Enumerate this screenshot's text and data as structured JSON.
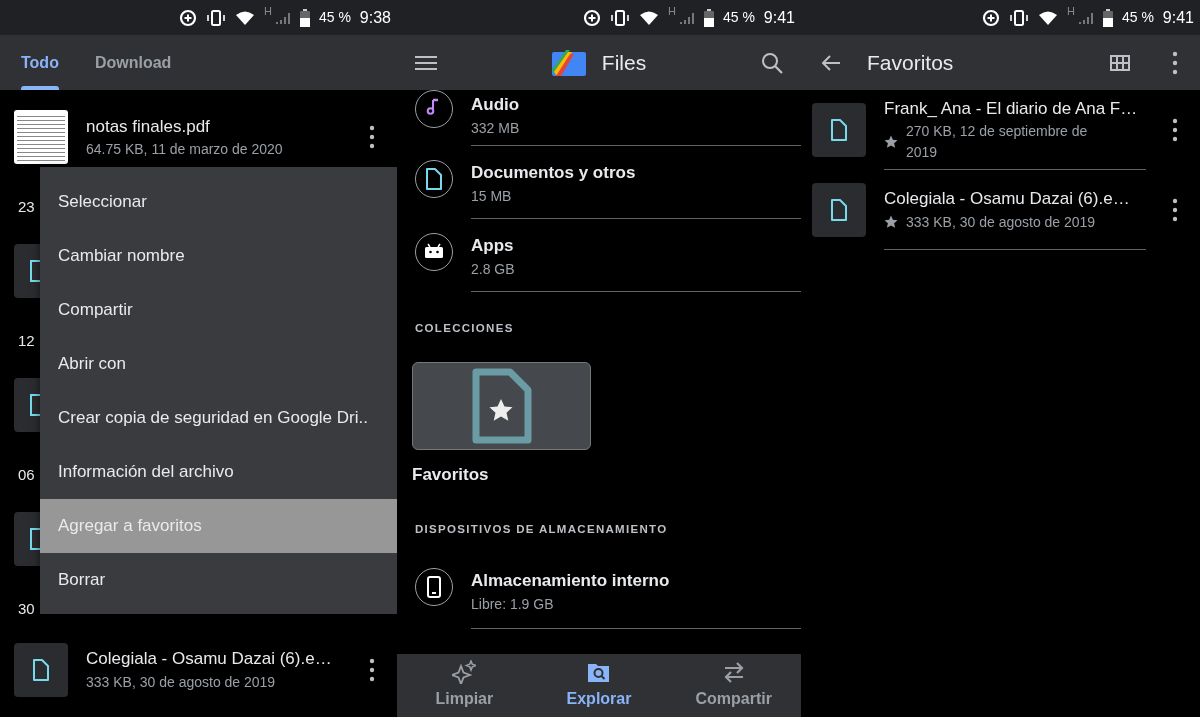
{
  "left_screen": {
    "status": {
      "network": "H",
      "battery": "45 %",
      "time": "9:38"
    },
    "tabs": [
      {
        "label": "Todo",
        "selected": true
      },
      {
        "label": "Download",
        "selected": false
      }
    ],
    "list": [
      {
        "kind": "file",
        "preview": true,
        "name": "notas finales.pdf",
        "meta": "64.75 KB, 11 de marzo de 2020"
      },
      {
        "kind": "date",
        "label": "23"
      },
      {
        "kind": "covered"
      },
      {
        "kind": "date",
        "label": "12"
      },
      {
        "kind": "covered"
      },
      {
        "kind": "date",
        "label": "06"
      },
      {
        "kind": "covered"
      },
      {
        "kind": "date",
        "label": "30"
      },
      {
        "kind": "file",
        "preview": false,
        "name": "Colegiala - Osamu Dazai (6).e…",
        "meta": "333 KB, 30 de agosto de 2019"
      }
    ],
    "menu": [
      {
        "label": "Seleccionar",
        "selected": false
      },
      {
        "label": "Cambiar nombre",
        "selected": false
      },
      {
        "label": "Compartir",
        "selected": false
      },
      {
        "label": "Abrir con",
        "selected": false
      },
      {
        "label": "Crear copia de seguridad en Google Dri..",
        "selected": false
      },
      {
        "label": "Información del archivo",
        "selected": false
      },
      {
        "label": "Agregar a favoritos",
        "selected": true
      },
      {
        "label": "Borrar",
        "selected": false
      }
    ]
  },
  "middle_screen": {
    "status": {
      "network": "H",
      "battery": "45 %",
      "time": "9:41"
    },
    "title": "Files",
    "categories": [
      {
        "kind": "audio",
        "name": "Audio",
        "size": "332 MB"
      },
      {
        "kind": "document",
        "name": "Documentos y otros",
        "size": "15 MB"
      },
      {
        "kind": "apps",
        "name": "Apps",
        "size": "2.8 GB"
      }
    ],
    "collections_header": "COLECCIONES",
    "collection": {
      "label": "Favoritos"
    },
    "storage_header": "DISPOSITIVOS DE ALMACENAMIENTO",
    "storage": [
      {
        "name": "Almacenamiento interno",
        "free": "Libre: 1.9 GB"
      }
    ],
    "bottom_nav": [
      {
        "kind": "clean",
        "label": "Limpiar",
        "selected": false
      },
      {
        "kind": "browse",
        "label": "Explorar",
        "selected": true
      },
      {
        "kind": "share",
        "label": "Compartir",
        "selected": false
      }
    ]
  },
  "right_screen": {
    "status": {
      "network": "H",
      "battery": "45 %",
      "time": "9:41"
    },
    "title": "Favoritos",
    "files": [
      {
        "name": "Frank_ Ana - El diario de Ana F…",
        "meta": "270 KB, 12 de septiembre de 2019",
        "starred": true
      },
      {
        "name": "Colegiala - Osamu Dazai (6).e…",
        "meta": "333 KB, 30 de agosto de 2019",
        "starred": true
      }
    ]
  }
}
